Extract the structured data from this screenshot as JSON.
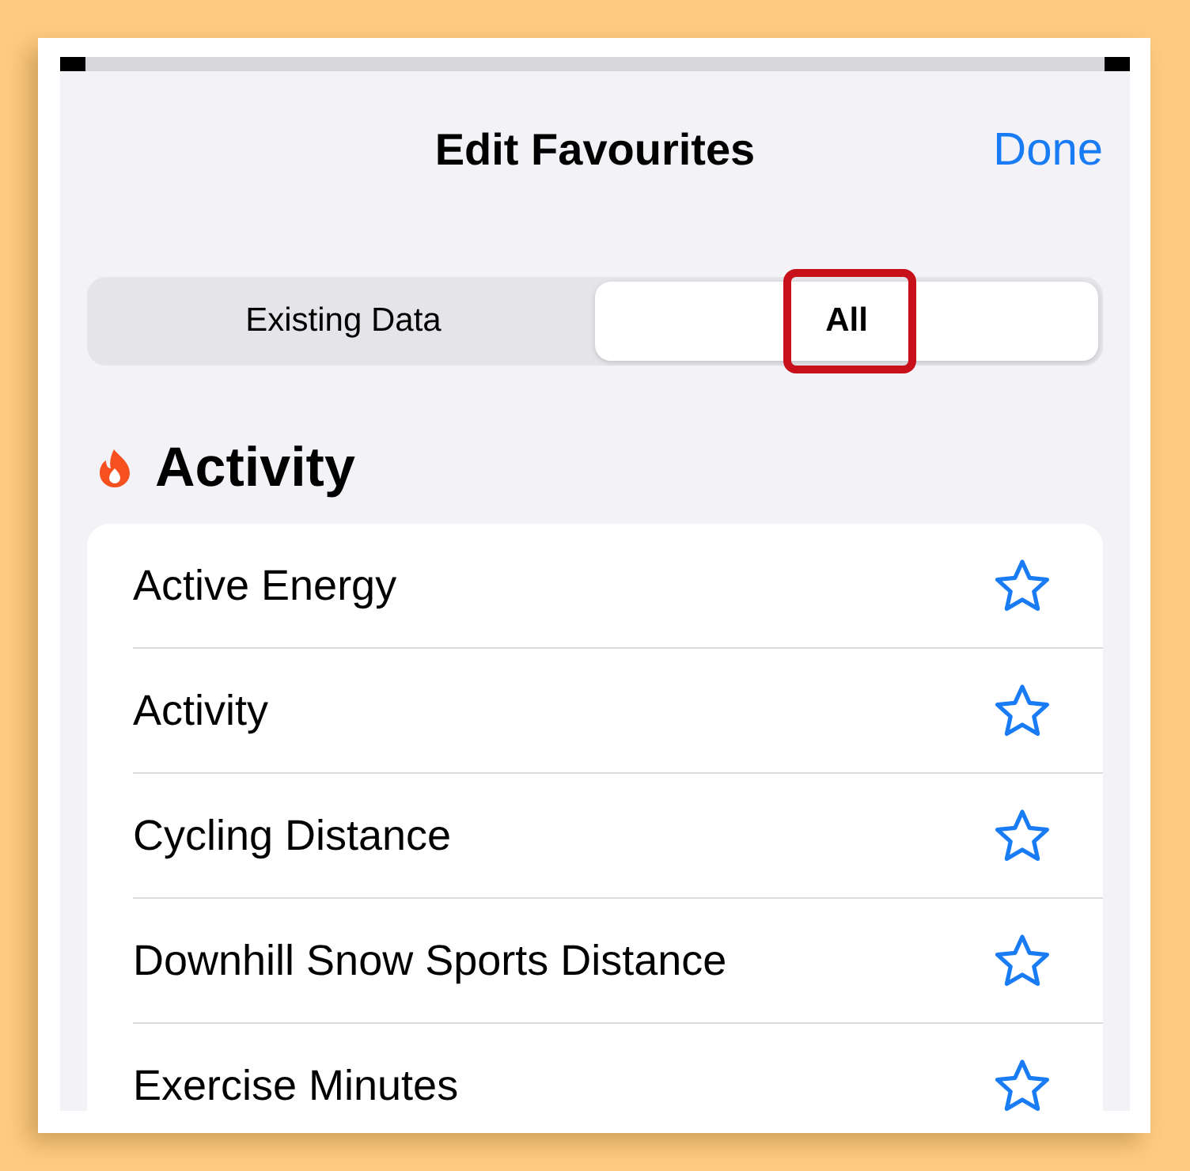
{
  "header": {
    "title": "Edit Favourites",
    "action": "Done"
  },
  "segments": [
    {
      "label": "Existing Data",
      "selected": false,
      "highlighted": false
    },
    {
      "label": "All",
      "selected": true,
      "highlighted": true
    }
  ],
  "section": {
    "title": "Activity"
  },
  "items": [
    {
      "label": "Active Energy",
      "favourite": false
    },
    {
      "label": "Activity",
      "favourite": false
    },
    {
      "label": "Cycling Distance",
      "favourite": false
    },
    {
      "label": "Downhill Snow Sports Distance",
      "favourite": false
    },
    {
      "label": "Exercise Minutes",
      "favourite": false
    }
  ]
}
